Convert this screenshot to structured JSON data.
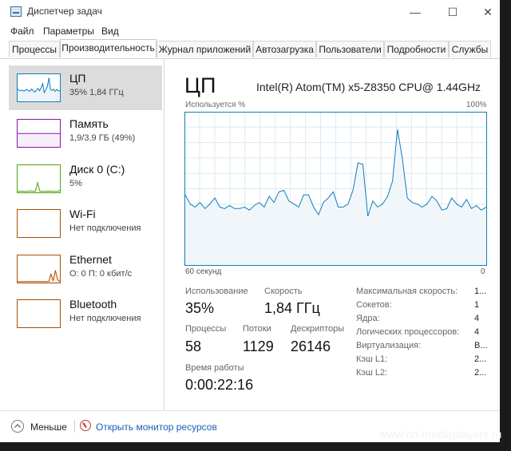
{
  "window": {
    "title": "Диспетчер задач",
    "minimize": "—",
    "maximize": "☐",
    "close": "✕"
  },
  "menu": [
    "Файл",
    "Параметры",
    "Вид"
  ],
  "tabs": [
    {
      "label": "Процессы",
      "active": false
    },
    {
      "label": "Производительность",
      "active": true
    },
    {
      "label": "Журнал приложений",
      "active": false
    },
    {
      "label": "Автозагрузка",
      "active": false
    },
    {
      "label": "Пользователи",
      "active": false
    },
    {
      "label": "Подробности",
      "active": false
    },
    {
      "label": "Службы",
      "active": false
    }
  ],
  "sidebar": {
    "items": [
      {
        "title": "ЦП",
        "sub": "35% 1,84 ГГц",
        "color": "#117dbb",
        "active": true
      },
      {
        "title": "Память",
        "sub": "1,9/3,9 ГБ (49%)",
        "color": "#8b12ae",
        "active": false
      },
      {
        "title": "Диск 0 (C:)",
        "sub": "5%",
        "color": "#4da60c",
        "active": false
      },
      {
        "title": "Wi-Fi",
        "sub": "Нет подключения",
        "color": "#a74f01",
        "active": false
      },
      {
        "title": "Ethernet",
        "sub": "О: 0 П: 0 кбит/с",
        "color": "#a74f01",
        "active": false
      },
      {
        "title": "Bluetooth",
        "sub": "Нет подключения",
        "color": "#a74f01",
        "active": false
      }
    ]
  },
  "main": {
    "title": "ЦП",
    "model": "Intel(R) Atom(TM) x5-Z8350 CPU@ 1.44GHz",
    "chart_label_left": "Используется %",
    "chart_label_right": "100%",
    "axis_left": "60 секунд",
    "axis_right": "0"
  },
  "stats": {
    "usage_label": "Использование",
    "usage_value": "35%",
    "speed_label": "Скорость",
    "speed_value": "1,84 ГГц",
    "processes_label": "Процессы",
    "processes_value": "58",
    "threads_label": "Потоки",
    "threads_value": "1129",
    "handles_label": "Дескрипторы",
    "handles_value": "26146",
    "uptime_label": "Время работы",
    "uptime_value": "0:00:22:16"
  },
  "specs": [
    {
      "label": "Максимальная скорость:",
      "value": "1..."
    },
    {
      "label": "Сокетов:",
      "value": "1"
    },
    {
      "label": "Ядра:",
      "value": "4"
    },
    {
      "label": "Логических процессоров:",
      "value": "4"
    },
    {
      "label": "Виртуализация:",
      "value": "В..."
    },
    {
      "label": "Кэш L1:",
      "value": "2..."
    },
    {
      "label": "Кэш L2:",
      "value": "2..."
    }
  ],
  "footer": {
    "less_label": "Меньше",
    "monitor_link": "Открыть монитор ресурсов"
  },
  "watermark": "www.hd-mediaplayers.ru",
  "colors": {
    "cpu_line": "#117dbb",
    "cpu_fill": "#f1f6fa",
    "grid": "#d9eaf4"
  },
  "chart_data": {
    "type": "area",
    "ylim": [
      0,
      100
    ],
    "x_direction": "60 секунд → 0",
    "values": [
      46,
      40,
      38,
      41,
      37,
      40,
      44,
      38,
      37,
      39,
      37,
      37,
      38,
      36,
      39,
      41,
      38,
      45,
      41,
      48,
      49,
      42,
      40,
      38,
      46,
      46,
      38,
      33,
      41,
      44,
      48,
      38,
      38,
      40,
      49,
      67,
      66,
      32,
      42,
      38,
      40,
      45,
      55,
      89,
      70,
      44,
      41,
      40,
      38,
      40,
      45,
      42,
      36,
      37,
      44,
      40,
      38,
      43,
      37,
      39,
      36,
      38
    ]
  },
  "sparks": {
    "cpu": [
      46,
      40,
      38,
      41,
      37,
      40,
      44,
      38,
      37,
      46,
      38,
      33,
      41,
      48,
      38,
      49,
      67,
      32,
      42,
      55,
      89,
      44,
      40,
      45,
      36,
      44,
      38,
      39
    ],
    "memory": [
      49,
      49,
      49,
      49,
      49,
      49,
      49,
      49,
      49,
      49,
      49,
      49,
      49,
      49,
      49,
      49,
      49,
      49,
      49,
      49
    ],
    "disk": [
      1,
      1,
      2,
      1,
      1,
      1,
      3,
      1,
      1,
      35,
      2,
      1,
      1,
      1,
      2,
      1,
      1,
      1,
      1,
      5
    ],
    "ethernet": [
      1,
      1,
      1,
      1,
      1,
      1,
      1,
      1,
      1,
      1,
      1,
      1,
      1,
      1,
      1,
      30,
      5,
      45,
      8,
      1
    ]
  }
}
